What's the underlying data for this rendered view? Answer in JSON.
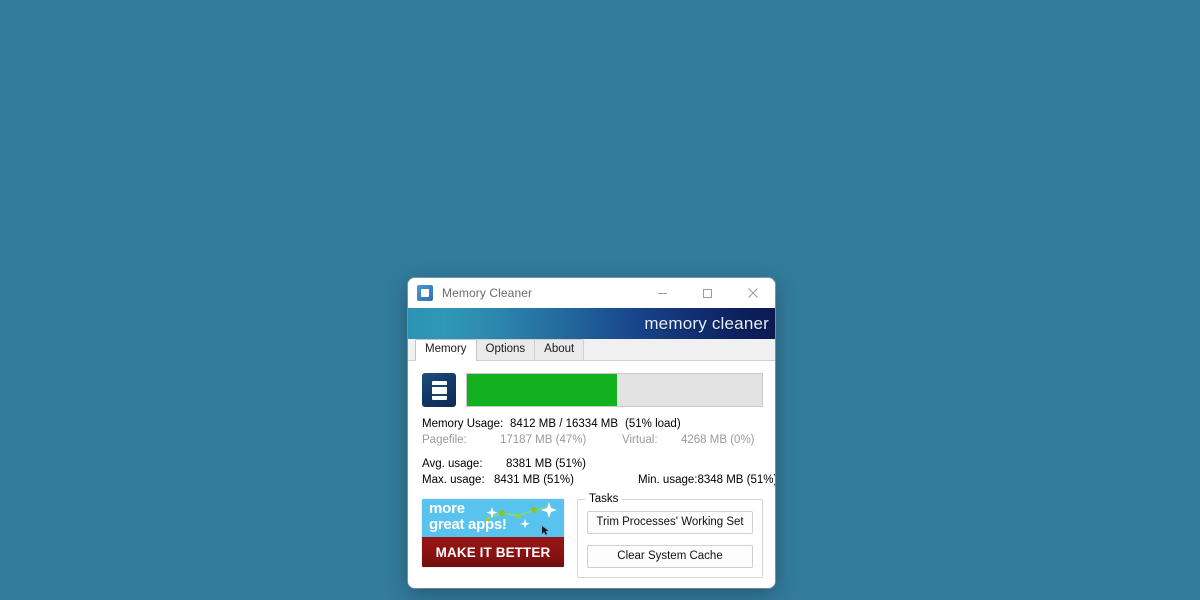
{
  "desktop": {
    "background_color": "#337b9b"
  },
  "window": {
    "title": "Memory Cleaner",
    "icon": "app-icon",
    "controls": {
      "minimize": "minimize-icon",
      "maximize": "maximize-icon",
      "close": "close-icon"
    }
  },
  "banner": {
    "title": "memory cleaner",
    "gradient_from": "#2b93b4",
    "gradient_to": "#0b1a52"
  },
  "tabs": [
    {
      "label": "Memory",
      "selected": true
    },
    {
      "label": "Options",
      "selected": false
    },
    {
      "label": "About",
      "selected": false
    }
  ],
  "gauge": {
    "icon": "ram-module-icon",
    "fill_percent": 51,
    "fill_color": "#12b120",
    "track_color": "#e3e3e3"
  },
  "stats": {
    "memory_usage_label": "Memory Usage:",
    "memory_usage_value": "8412 MB / 16334 MB",
    "memory_usage_load": "(51% load)",
    "pagefile_label": "Pagefile:",
    "pagefile_value": "17187 MB (47%)",
    "virtual_label": "Virtual:",
    "virtual_value": "4268 MB (0%)",
    "avg_label": "Avg. usage:",
    "avg_value": "8381 MB (51%)",
    "max_label": "Max. usage:",
    "max_value": "8431 MB (51%)",
    "min_label": "Min. usage:",
    "min_value": "8348 MB (51%)"
  },
  "ad": {
    "line1": "more",
    "line2": "great apps!",
    "cta": "MAKE IT BETTER",
    "top_color": "#59c3ef",
    "bottom_color": "#8a1212"
  },
  "tasks": {
    "legend": "Tasks",
    "buttons": [
      {
        "label": "Trim Processes' Working Set"
      },
      {
        "label": "Clear System Cache"
      }
    ]
  }
}
